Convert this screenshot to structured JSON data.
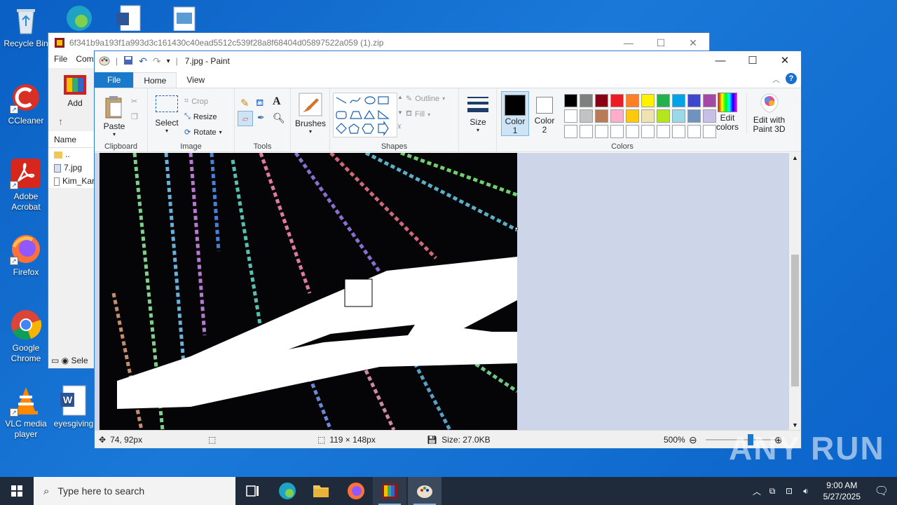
{
  "desktop": {
    "icons": [
      {
        "label": "Recycle Bin",
        "icon": "recycle-bin-icon"
      },
      {
        "label": "CCleaner",
        "icon": "ccleaner-icon"
      },
      {
        "label": "Adobe Acrobat",
        "icon": "acrobat-icon"
      },
      {
        "label": "Firefox",
        "icon": "firefox-icon"
      },
      {
        "label": "Google Chrome",
        "icon": "chrome-icon"
      },
      {
        "label": "VLC media player",
        "icon": "vlc-icon"
      },
      {
        "label": "eyesgiving",
        "icon": "word-doc-icon"
      }
    ]
  },
  "winrar": {
    "title": "6f341b9a193f1a993d3c161430c40ead5512c539f28a8f68404d05897522a059 (1).zip",
    "menu": [
      "File",
      "Com"
    ],
    "add_label": "Add",
    "files_header": "Name",
    "files": [
      "..",
      "7.jpg",
      "Kim_Kar"
    ],
    "status": "Sele"
  },
  "paint": {
    "title": "7.jpg - Paint",
    "tabs": [
      "File",
      "Home",
      "View"
    ],
    "groups": {
      "clipboard": {
        "label": "Clipboard",
        "paste": "Paste"
      },
      "image": {
        "label": "Image",
        "select": "Select",
        "crop": "Crop",
        "resize": "Resize",
        "rotate": "Rotate"
      },
      "tools": {
        "label": "Tools"
      },
      "brushes": {
        "label": "Brushes"
      },
      "shapes": {
        "label": "Shapes",
        "outline": "Outline",
        "fill": "Fill"
      },
      "size": {
        "label": "Size"
      },
      "colors": {
        "label": "Colors",
        "color1": "Color\n1",
        "color2": "Color\n2",
        "edit_colors": "Edit colors"
      },
      "paint3d": {
        "label": "Edit with Paint 3D"
      }
    },
    "palette": [
      "#000000",
      "#7f7f7f",
      "#880015",
      "#ed1c24",
      "#ff7f27",
      "#fff200",
      "#22b14c",
      "#00a2e8",
      "#3f48cc",
      "#a349a4",
      "#ffffff",
      "#c3c3c3",
      "#b97a57",
      "#ffaec9",
      "#ffc90e",
      "#efe4b0",
      "#b5e61d",
      "#99d9ea",
      "#7092be",
      "#c8bfe7",
      "#ffffff",
      "#ffffff",
      "#ffffff",
      "#ffffff",
      "#ffffff",
      "#ffffff",
      "#ffffff",
      "#ffffff",
      "#ffffff",
      "#ffffff"
    ],
    "color1": "#000000",
    "color2": "#ffffff",
    "status": {
      "cursor": "74, 92px",
      "selection": "119 × 148px",
      "size": "Size: 27.0KB",
      "zoom": "500%"
    }
  },
  "taskbar": {
    "search_placeholder": "Type here to search",
    "time": "9:00 AM",
    "date": "5/27/2025"
  },
  "watermark": "ANY RUN"
}
